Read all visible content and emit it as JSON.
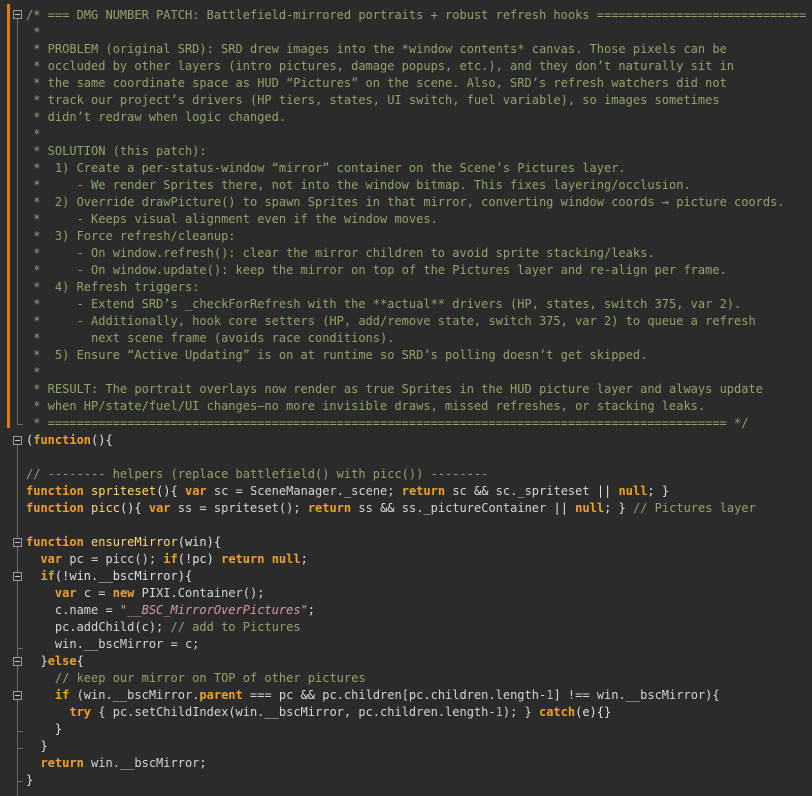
{
  "editor": {
    "language": "javascript",
    "colors": {
      "background": "#2b2b2b",
      "comment": "#8fa46a",
      "keyword": "#f0a028",
      "function_name": "#ffd966",
      "string": "#d49aa0",
      "number": "#9fc79f",
      "text": "#d4d4d4",
      "change_marker": "#e07b00"
    }
  },
  "lines": [
    [
      [
        "c",
        "/* === DMG NUMBER PATCH: Battlefield-mirrored portraits + robust refresh hooks ============================="
      ]
    ],
    [
      [
        "c",
        " *"
      ]
    ],
    [
      [
        "c",
        " * PROBLEM (original SRD): SRD drew images into the *window contents* canvas. Those pixels can be"
      ]
    ],
    [
      [
        "c",
        " * occluded by other layers (intro pictures, damage popups, etc.), and they don’t naturally sit in"
      ]
    ],
    [
      [
        "c",
        " * the same coordinate space as HUD “Pictures” on the scene. Also, SRD’s refresh watchers did not"
      ]
    ],
    [
      [
        "c",
        " * track our project’s drivers (HP tiers, states, UI switch, fuel variable), so images sometimes"
      ]
    ],
    [
      [
        "c",
        " * didn’t redraw when logic changed."
      ]
    ],
    [
      [
        "c",
        " *"
      ]
    ],
    [
      [
        "c",
        " * SOLUTION (this patch):"
      ]
    ],
    [
      [
        "c",
        " *  1) Create a per-status-window “mirror” container on the Scene’s Pictures layer."
      ]
    ],
    [
      [
        "c",
        " *     - We render Sprites there, not into the window bitmap. This fixes layering/occlusion."
      ]
    ],
    [
      [
        "c",
        " *  2) Override drawPicture() to spawn Sprites in that mirror, converting window coords → picture coords."
      ]
    ],
    [
      [
        "c",
        " *     - Keeps visual alignment even if the window moves."
      ]
    ],
    [
      [
        "c",
        " *  3) Force refresh/cleanup:"
      ]
    ],
    [
      [
        "c",
        " *     - On window.refresh(): clear the mirror children to avoid sprite stacking/leaks."
      ]
    ],
    [
      [
        "c",
        " *     - On window.update(): keep the mirror on top of the Pictures layer and re-align per frame."
      ]
    ],
    [
      [
        "c",
        " *  4) Refresh triggers:"
      ]
    ],
    [
      [
        "c",
        " *     - Extend SRD’s _checkForRefresh with the **actual** drivers (HP, states, switch 375, var 2)."
      ]
    ],
    [
      [
        "c",
        " *     - Additionally, hook core setters (HP, add/remove state, switch 375, var 2) to queue a refresh"
      ]
    ],
    [
      [
        "c",
        " *       next scene frame (avoids race conditions)."
      ]
    ],
    [
      [
        "c",
        " *  5) Ensure “Active Updating” is on at runtime so SRD’s polling doesn’t get skipped."
      ]
    ],
    [
      [
        "c",
        " *"
      ]
    ],
    [
      [
        "c",
        " * RESULT: The portrait overlays now render as true Sprites in the HUD picture layer and always update"
      ]
    ],
    [
      [
        "c",
        " * when HP/state/fuel/UI changes—no more invisible draws, missed refreshes, or stacking leaks."
      ]
    ],
    [
      [
        "c",
        " * ============================================================================================== */"
      ]
    ],
    [
      [
        "p",
        "("
      ],
      [
        "k",
        "function"
      ],
      [
        "p",
        "(){"
      ]
    ],
    [],
    [
      [
        "c",
        "// -------- helpers (replace battlefield() with picc()) --------"
      ]
    ],
    [
      [
        "k",
        "function"
      ],
      [
        "t",
        " "
      ],
      [
        "f",
        "spriteset"
      ],
      [
        "p",
        "(){ "
      ],
      [
        "k",
        "var"
      ],
      [
        "t",
        " sc = SceneManager._scene; "
      ],
      [
        "k",
        "return"
      ],
      [
        "t",
        " sc "
      ],
      [
        "p",
        "&&"
      ],
      [
        "t",
        " sc._spriteset "
      ],
      [
        "p",
        "||"
      ],
      [
        "t",
        " "
      ],
      [
        "k",
        "null"
      ],
      [
        "p",
        "; }"
      ]
    ],
    [
      [
        "k",
        "function"
      ],
      [
        "t",
        " "
      ],
      [
        "f",
        "picc"
      ],
      [
        "p",
        "(){ "
      ],
      [
        "k",
        "var"
      ],
      [
        "t",
        " ss = spriteset(); "
      ],
      [
        "k",
        "return"
      ],
      [
        "t",
        " ss "
      ],
      [
        "p",
        "&&"
      ],
      [
        "t",
        " ss._pictureContainer "
      ],
      [
        "p",
        "||"
      ],
      [
        "t",
        " "
      ],
      [
        "k",
        "null"
      ],
      [
        "p",
        "; }"
      ],
      [
        "t",
        " "
      ],
      [
        "c",
        "// Pictures layer"
      ]
    ],
    [],
    [
      [
        "k",
        "function"
      ],
      [
        "t",
        " "
      ],
      [
        "f",
        "ensureMirror"
      ],
      [
        "p",
        "(win){"
      ]
    ],
    [
      [
        "t",
        "  "
      ],
      [
        "k",
        "var"
      ],
      [
        "t",
        " pc = picc(); "
      ],
      [
        "k",
        "if"
      ],
      [
        "p",
        "(!pc) "
      ],
      [
        "k",
        "return"
      ],
      [
        "t",
        " "
      ],
      [
        "k",
        "null"
      ],
      [
        "p",
        ";"
      ]
    ],
    [
      [
        "t",
        "  "
      ],
      [
        "k",
        "if"
      ],
      [
        "p",
        "(!win.__bscMirror){"
      ]
    ],
    [
      [
        "t",
        "    "
      ],
      [
        "k",
        "var"
      ],
      [
        "t",
        " c = "
      ],
      [
        "k",
        "new"
      ],
      [
        "t",
        " PIXI.Container();"
      ]
    ],
    [
      [
        "t",
        "    c.name = "
      ],
      [
        "s",
        "\"__BSC_MirrorOverPictures\""
      ],
      [
        "p",
        ";"
      ]
    ],
    [
      [
        "t",
        "    pc.addChild(c); "
      ],
      [
        "c",
        "// add to Pictures"
      ]
    ],
    [
      [
        "t",
        "    win.__bscMirror = c;"
      ]
    ],
    [
      [
        "t",
        "  "
      ],
      [
        "p",
        "}"
      ],
      [
        "k",
        "else"
      ],
      [
        "p",
        "{"
      ]
    ],
    [
      [
        "t",
        "    "
      ],
      [
        "c",
        "// keep our mirror on TOP of other pictures"
      ]
    ],
    [
      [
        "t",
        "    "
      ],
      [
        "k",
        "if"
      ],
      [
        "t",
        " (win.__bscMirror."
      ],
      [
        "k",
        "parent"
      ],
      [
        "t",
        " === pc "
      ],
      [
        "p",
        "&&"
      ],
      [
        "t",
        " pc.children[pc.children.length-"
      ],
      [
        "n",
        "1"
      ],
      [
        "t",
        "] !== win.__bscMirror){"
      ]
    ],
    [
      [
        "t",
        "      "
      ],
      [
        "k",
        "try"
      ],
      [
        "t",
        " { pc.setChildIndex(win.__bscMirror, pc.children.length-"
      ],
      [
        "n",
        "1"
      ],
      [
        "t",
        "); } "
      ],
      [
        "k",
        "catch"
      ],
      [
        "p",
        "(e){}"
      ]
    ],
    [
      [
        "t",
        "    "
      ],
      [
        "p",
        "}"
      ]
    ],
    [
      [
        "t",
        "  "
      ],
      [
        "p",
        "}"
      ]
    ],
    [
      [
        "t",
        "  "
      ],
      [
        "k",
        "return"
      ],
      [
        "t",
        " win.__bscMirror;"
      ]
    ],
    [
      [
        "p",
        "}"
      ]
    ]
  ]
}
